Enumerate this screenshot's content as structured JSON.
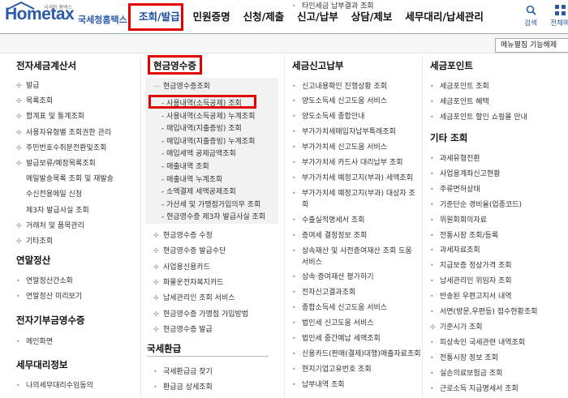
{
  "logo": {
    "brand": "Hometax",
    "sub": "국세청 홈택스",
    "korean": "국세청홈택스"
  },
  "gnb": [
    {
      "label": "조회/발급",
      "active": true
    },
    {
      "label": "민원증명",
      "active": false
    },
    {
      "label": "신청/제출",
      "active": false
    },
    {
      "label": "신고/납부",
      "active": false
    },
    {
      "label": "상담/제보",
      "active": false
    },
    {
      "label": "세무대리/납세관리",
      "active": false
    }
  ],
  "util": {
    "search": "검색",
    "all": "전체메"
  },
  "dropdown": "메뉴펼침 기능해제",
  "col1": {
    "title": "전자세금계산서",
    "items": [
      "발급",
      "목록조회",
      "합계표 및 통계조회",
      "사용자유형별 조회권한 관리",
      "주민번호수취분전환및조회",
      "발급보류/예정목록조회"
    ],
    "subitems": [
      "메일발송목록 조회 및 재발송",
      "수신전용메일 신청",
      "제3자 발급사실 조회"
    ],
    "items2": [
      "거래처 및 품목관리",
      "기타조회"
    ],
    "title2": "연말정산",
    "items3": [
      "연말정산간소화",
      "연말정산 미리보기"
    ],
    "title3": "전자기부금영수증",
    "items4": [
      "메인화면"
    ],
    "title4": "세무대리정보",
    "items5": [
      "나의세무대리수임동의"
    ]
  },
  "col2": {
    "title": "현금영수증",
    "group": "현금영수증조회",
    "subitems": [
      "사용내역(소득공제) 조회",
      "사용내역(소득공제) 누계조회",
      "매입내역(지출증빙) 조회",
      "매입내역(지출증빙) 누계조회",
      "매입세액 공제금액조회",
      "매출내역 조회",
      "매출내역 누계조회",
      "소액결제 세액공제조회",
      "가산세 및 가맹점가입의무 조회",
      "현금영수증 제3자 발급사실 조회"
    ],
    "items": [
      "현금영수증 수정",
      "현금영수증 발급수단",
      "사업용신용카드",
      "화물운전자복지카드",
      "납세관리인 조회 서비스",
      "현금영수증 가맹점 가입방법",
      "현금영수증 발급"
    ],
    "title2": "국세환급",
    "items2": [
      "국세환급금 찾기",
      "환급금 상세조회"
    ]
  },
  "col3": {
    "title": "세금신고납부",
    "items": [
      "신고내용확인 진행상황 조회",
      "양도소득세 신고도움 서비스",
      "양도소득세 종합안내",
      "부가가치세매입자납부특례조회",
      "부가가치세 신고도움 서비스",
      "부가가치세 카드사 대리납부 조회",
      "부가가치세 예정고지(부과) 세액조회",
      "부가가치세 예정고지(부과) 대상자 조",
      "회",
      "수출실적명세서 조회",
      "증여세 결정정보 조회",
      "상속재산 및 사전증여재산 조회 도움",
      "서비스",
      "상속·증여재산 평가하기",
      "전자신고결과조회",
      "종합소득세 신고도움 서비스",
      "법인세 신고도움 서비스",
      "법인세 중간예납 세액조회",
      "신용카드(판매(결제)대행)매출자료조회",
      "현지기업고유번호 조회",
      "납부내역 조회",
      "타인세금 납부결과 조회"
    ]
  },
  "col4": {
    "title": "세금포인트",
    "items": [
      "세금포인트 조회",
      "세금포인트 혜택",
      "세금포인트 할인 쇼핑몰 안내"
    ],
    "title2": "기타 조회",
    "items2": [
      "과세유형전환",
      "사업용계좌신고현황",
      "주류면허상태",
      "기준단순 경비율(업종코드)",
      "위원회회의자료",
      "전통시장 조회/등록",
      "과세자료조회",
      "지급보증 정상가격 조회",
      "납세관리인 위임자 조회",
      "반송된 우편고지서 내역",
      "서면(방문,우편등) 접수현황조회",
      "기준시가 조회",
      "피상속인 국세관련 내역조회",
      "전통시장 정보 조회",
      "실손의료보험금 조회",
      "근로소득 지급명세서 조회"
    ]
  }
}
